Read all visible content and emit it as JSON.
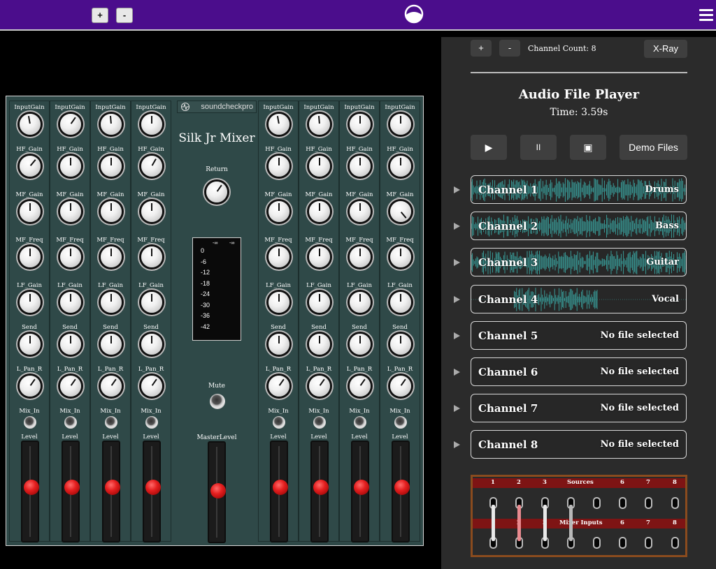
{
  "topbar": {
    "zoom_in": "+",
    "zoom_out": "-"
  },
  "mixer": {
    "title": "Silk Jr Mixer",
    "brand": "soundcheckpro",
    "strip_labels": [
      "InputGain",
      "HF_Gain",
      "MF_Gain",
      "MF_Freq",
      "LF_Gain",
      "Send",
      "L_Pan_R",
      "Mix_In",
      "Level"
    ],
    "return_label": "Return",
    "mute_label": "Mute",
    "master_label": "MasterLevel",
    "meter": {
      "top_left": "-∞",
      "top_right": "-∞",
      "scale": [
        "0",
        "-6",
        "-12",
        "-18",
        "-24",
        "-30",
        "-36",
        "-42"
      ]
    }
  },
  "panel": {
    "plus": "+",
    "minus": "-",
    "channel_count": "Channel Count: 8",
    "xray": "X-Ray",
    "title": "Audio File Player",
    "time": "Time: 3.59s",
    "play": "▶",
    "pause": "II",
    "stop": "▣",
    "demo": "Demo Files",
    "channels": [
      {
        "name": "Channel 1",
        "file": "Drums"
      },
      {
        "name": "Channel 2",
        "file": "Bass"
      },
      {
        "name": "Channel 3",
        "file": "Guitar"
      },
      {
        "name": "Channel 4",
        "file": "Vocal"
      },
      {
        "name": "Channel 5",
        "file": "No file selected"
      },
      {
        "name": "Channel 6",
        "file": "No file selected"
      },
      {
        "name": "Channel 7",
        "file": "No file selected"
      },
      {
        "name": "Channel 8",
        "file": "No file selected"
      }
    ],
    "patchbay": {
      "sources_label": "Sources",
      "inputs_label": "Mixer Inputs",
      "nums": [
        "1",
        "2",
        "3",
        "6",
        "7",
        "8"
      ]
    }
  },
  "colors": {
    "topbar": "#4b0d8c",
    "mixer": "#2f4948",
    "wave": "#3aa7a3",
    "fader_cap": "#e41f1f",
    "patch_band": "#7e1414"
  }
}
